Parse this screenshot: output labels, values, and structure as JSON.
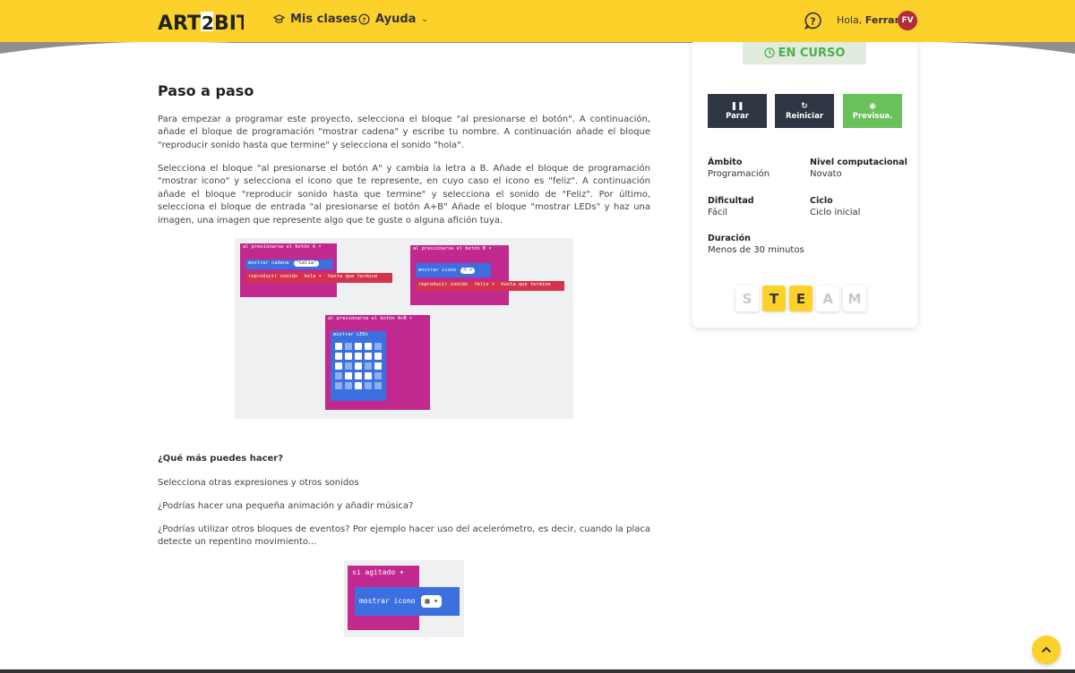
{
  "header": {
    "logo_text": "ART2BIT",
    "nav": [
      {
        "label": "Mis clases",
        "icon": "graduation-cap-icon"
      },
      {
        "label": "Ayuda",
        "icon": "help-circle-icon"
      }
    ],
    "greeting": "Hola,",
    "user_name": "Ferran",
    "avatar_initials": "FV",
    "colors": {
      "brand_yellow": "#fcd12a",
      "avatar": "#b42b3b"
    }
  },
  "content": {
    "title": "Paso a paso",
    "p1": "Para empezar a programar este proyecto, selecciona el bloque \"al presionarse el botón\". A continuación, añade el bloque de programación \"mostrar cadena\" y escribe tu nombre. A continuación añade el bloque \"reproducir sonido hasta que termine\" y selecciona el sonido \"hola\".",
    "p2": "Selecciona el bloque \"al presionarse el botón A\" y cambia la letra a B. Añade el bloque de programación \"mostrar icono\" y selecciona el icono que te represente, en cuyo caso el icono es \"feliz\". A continuación añade el bloque \"reproducir sonido hasta que termine\" y selecciona el sonido de \"Feliz\". Por último, selecciona el bloque de entrada \"al presionarse el botón A+B\" Añade el bloque \"mostrar LEDs\" y haz una imagen, una imagen que represente algo que te guste o alguna afición tuya.",
    "question": "¿Qué más puedes hacer?",
    "s1": "Selecciona otras expresiones y otros sonidos",
    "s2": "¿Podrías hacer una pequeña animación y añadir música?",
    "s3": "¿Podrías utilizar otros bloques de eventos? Por ejemplo hacer uso del acelerómetro, es decir, cuando la placa detecte un repentino movimiento...",
    "blocks": {
      "a_event": "al presionarse el botón  A ▾",
      "a_cmd": "mostrar cadena",
      "a_val": "\"Celia\"",
      "a_sound": "reproducir sonido",
      "a_sound_val": "hola ▾",
      "a_until": "hasta que termine",
      "b_event": "al presionarse el botón  B ▾",
      "b_cmd": "mostrar icono",
      "b_sound": "reproducir sonido",
      "b_sound_val": "feliz ▾",
      "b_until": "hasta que termine",
      "ab_event": "al presionarse el botón  A+B ▾",
      "ab_cmd": "mostrar LEDs",
      "shake_event": "si  agitado ▾",
      "shake_cmd": "mostrar icono"
    }
  },
  "sidebar": {
    "status": "EN CURSO",
    "status_color": "#4caf50",
    "buttons": [
      {
        "label": "Parar",
        "icon": "pause-icon"
      },
      {
        "label": "Reiniciar",
        "icon": "refresh-icon"
      },
      {
        "label": "Previsua.",
        "icon": "eye-icon"
      }
    ],
    "meta": {
      "ambito_label": "Ámbito",
      "ambito": "Programación",
      "nivel_label": "Nivel computacional",
      "nivel": "Novato",
      "dificultad_label": "Dificultad",
      "dificultad": "Fácil",
      "ciclo_label": "Ciclo",
      "ciclo": "Ciclo inicial",
      "duracion_label": "Duración",
      "duracion": "Menos de 30 minutos"
    },
    "steam": [
      {
        "letter": "S",
        "active": false
      },
      {
        "letter": "T",
        "active": true
      },
      {
        "letter": "E",
        "active": true
      },
      {
        "letter": "A",
        "active": false
      },
      {
        "letter": "M",
        "active": false
      }
    ]
  }
}
